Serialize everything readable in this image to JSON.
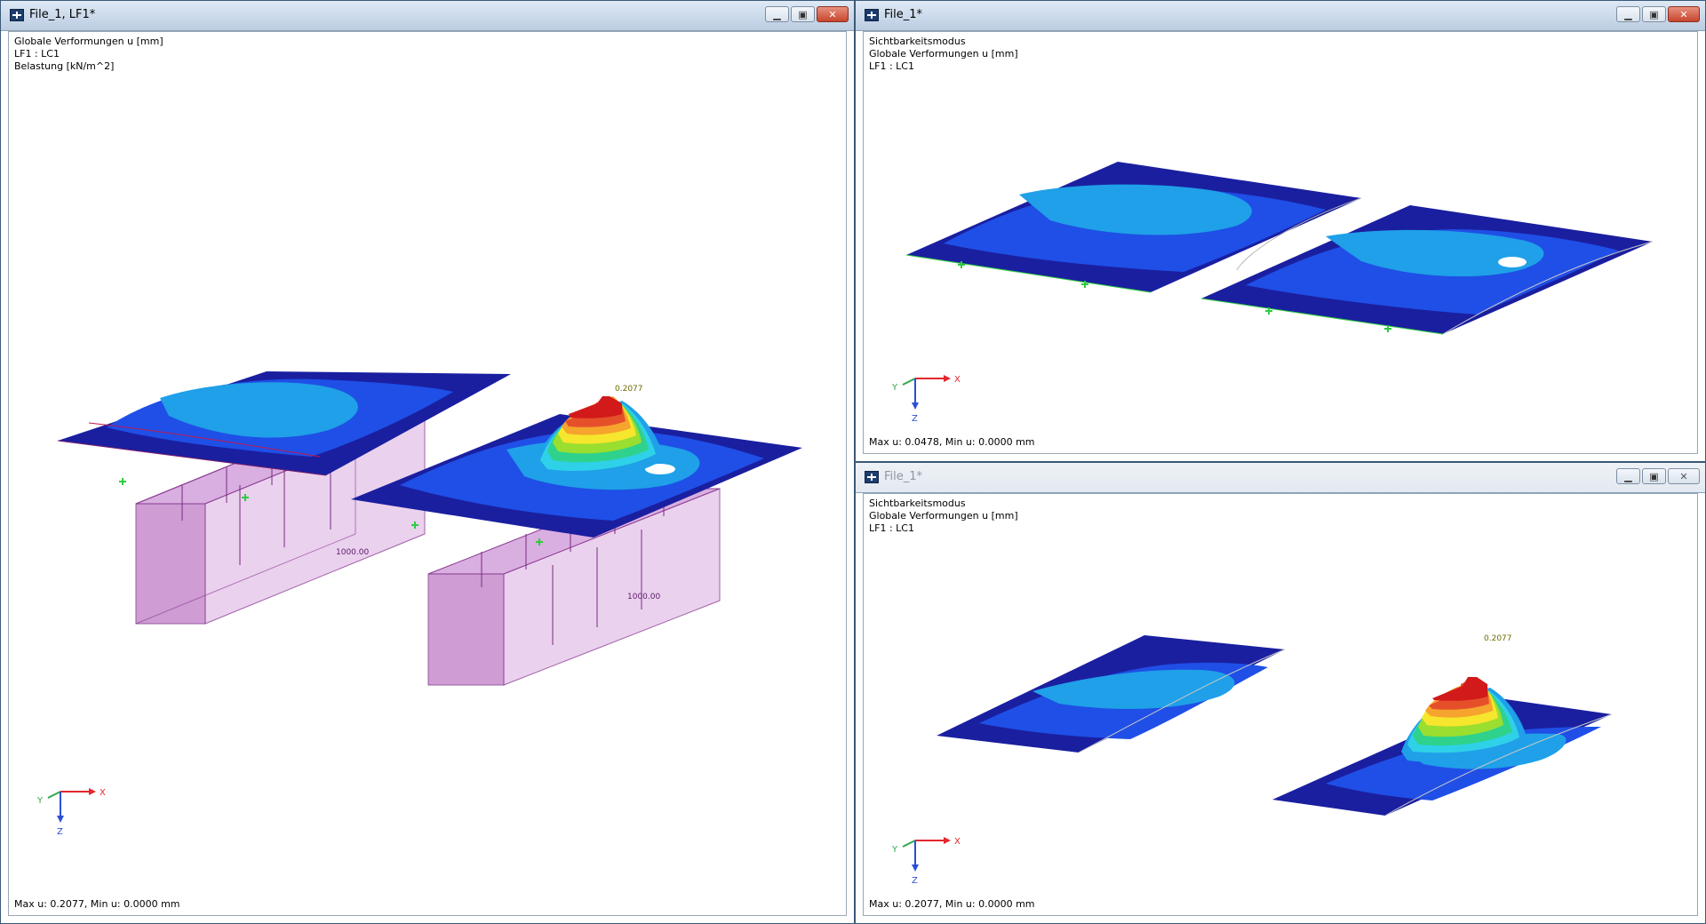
{
  "windows": {
    "left": {
      "title": "File_1, LF1*",
      "info": [
        "Globale Verformungen u [mm]",
        "LF1 : LC1",
        "Belastung [kN/m^2]"
      ],
      "status": "Max u: 0.2077, Min u: 0.0000 mm",
      "peak_label": "0.2077",
      "load_labels": [
        "1000.00",
        "1000.00"
      ]
    },
    "top_right": {
      "title": "File_1*",
      "info": [
        "Sichtbarkeitsmodus",
        "Globale Verformungen u [mm]",
        "LF1 : LC1"
      ],
      "status": "Max u: 0.0478, Min u: 0.0000 mm"
    },
    "bottom_right": {
      "title": "File_1*",
      "info": [
        "Sichtbarkeitsmodus",
        "Globale Verformungen u [mm]",
        "LF1 : LC1"
      ],
      "status": "Max u: 0.2077, Min u: 0.0000 mm",
      "peak_label": "0.2077"
    }
  },
  "axes": {
    "x": "X",
    "y": "Y",
    "z": "Z"
  },
  "icons": {
    "minimize": "minimize-icon",
    "maximize": "maximize-icon",
    "close": "close-icon",
    "app": "app-icon"
  },
  "colors": {
    "deep_blue": "#1a1fa0",
    "mid_blue": "#1f4fe6",
    "light_blue": "#1fa0e8",
    "load_fill": "#c48ac8",
    "support": "#2ecc40",
    "axis_x": "#e3272d",
    "axis_y": "#2fa84a",
    "axis_z": "#2a4fd6"
  }
}
